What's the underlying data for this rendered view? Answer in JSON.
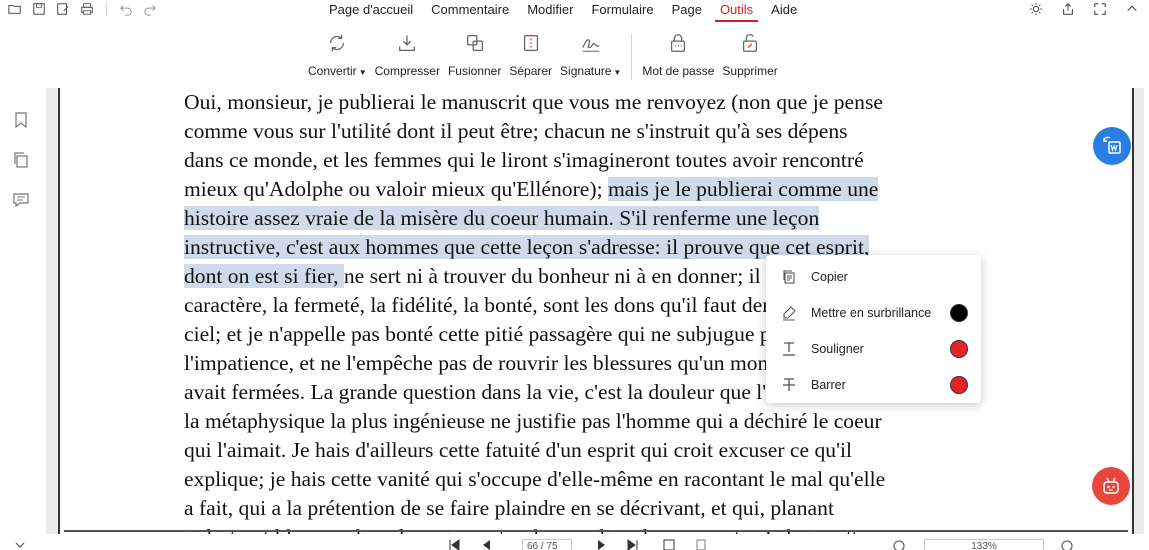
{
  "menu": {
    "items": [
      {
        "label": "Page d'accueil",
        "active": false
      },
      {
        "label": "Commentaire",
        "active": false
      },
      {
        "label": "Modifier",
        "active": false
      },
      {
        "label": "Formulaire",
        "active": false
      },
      {
        "label": "Page",
        "active": false
      },
      {
        "label": "Outils",
        "active": true
      },
      {
        "label": "Aide",
        "active": false
      }
    ]
  },
  "quick_access_icons": [
    "open-folder-icon",
    "save-icon",
    "save-as-icon",
    "print-icon",
    "undo-icon",
    "redo-icon"
  ],
  "window_controls_icons": [
    "theme-sun-icon",
    "share-icon",
    "fullscreen-icon",
    "collapse-ribbon-icon"
  ],
  "toolbar": {
    "convertir": "Convertir",
    "compresser": "Compresser",
    "fusionner": "Fusionner",
    "separer": "Séparer",
    "signature": "Signature",
    "mot_de_passe": "Mot de passe",
    "supprimer": "Supprimer"
  },
  "sidebar_icons": [
    "bookmark-icon",
    "pages-icon",
    "comment-icon"
  ],
  "document": {
    "lines": [
      {
        "segments": [
          {
            "text": "Oui, monsieur, je publierai le manuscrit que vous me renvoyez (non que je pense",
            "highlighted": false
          }
        ]
      },
      {
        "segments": [
          {
            "text": "comme vous sur l'utilité dont il peut être; chacun ne s'instruit qu'à ses dépens",
            "highlighted": false
          }
        ]
      },
      {
        "segments": [
          {
            "text": "dans ce monde, et les femmes qui le liront s'imagineront toutes avoir rencontré",
            "highlighted": false
          }
        ]
      },
      {
        "segments": [
          {
            "text": "mieux qu'Adolphe ou valoir mieux qu'Ellénore); ",
            "highlighted": false
          },
          {
            "text": "mais je le publierai comme une",
            "highlighted": true
          }
        ]
      },
      {
        "segments": [
          {
            "text": "histoire assez vraie de la misère du coeur humain. S'il renferme une leçon",
            "highlighted": true
          }
        ]
      },
      {
        "segments": [
          {
            "text": "instructive, c'est aux hommes que cette leçon s'adresse: il prouve que cet esprit, ",
            "highlighted": true
          }
        ]
      },
      {
        "segments": [
          {
            "text": "dont on est si fier, ",
            "highlighted": true
          },
          {
            "text": "ne sert ni à trouver du bonheur ni à en donner; il prouve que le",
            "highlighted": false
          }
        ]
      },
      {
        "segments": [
          {
            "text": "caractère, la fermeté, la fidélité, la bonté, sont les dons qu'il faut demander au",
            "highlighted": false
          }
        ]
      },
      {
        "segments": [
          {
            "text": "ciel; et je n'appelle pas bonté cette pitié passagère qui ne subjugue point",
            "highlighted": false
          }
        ]
      },
      {
        "segments": [
          {
            "text": "l'impatience, et ne l'empêche pas de rouvrir les blessures qu'un moment de regret",
            "highlighted": false
          }
        ]
      },
      {
        "segments": [
          {
            "text": "avait fermées. La grande question dans la vie, c'est la douleur que l'on cause, et",
            "highlighted": false
          }
        ]
      },
      {
        "segments": [
          {
            "text": "la métaphysique la plus ingénieuse ne justifie pas l'homme qui a déchiré le coeur",
            "highlighted": false
          }
        ]
      },
      {
        "segments": [
          {
            "text": "qui l'aimait. Je hais d'ailleurs cette fatuité d'un esprit qui croit excuser ce qu'il",
            "highlighted": false
          }
        ]
      },
      {
        "segments": [
          {
            "text": "explique; je hais cette vanité qui s'occupe d'elle-même en racontant le mal qu'elle",
            "highlighted": false
          }
        ]
      },
      {
        "segments": [
          {
            "text": "a fait, qui a la prétention de se faire plaindre en se décrivant, et qui, planant",
            "highlighted": false
          }
        ]
      },
      {
        "segments": [
          {
            "text": "indestructible au milieu des ruines, s'analyse au lieu de se repentir. Je hais cette",
            "highlighted": false
          }
        ]
      }
    ]
  },
  "context_menu": {
    "copy": "Copier",
    "highlight": "Mettre en surbrillance",
    "underline": "Souligner",
    "strikethrough": "Barrer",
    "highlight_color": "#000000",
    "underline_color": "#e8212a",
    "strikethrough_color": "#e8212a"
  },
  "statusbar": {
    "page": "66 / 75",
    "zoom": "133%"
  },
  "colors": {
    "accent": "#d81e2a",
    "selection": "#cfdbea",
    "fab_blue": "#2a7de1",
    "fab_red": "#e8473e"
  }
}
